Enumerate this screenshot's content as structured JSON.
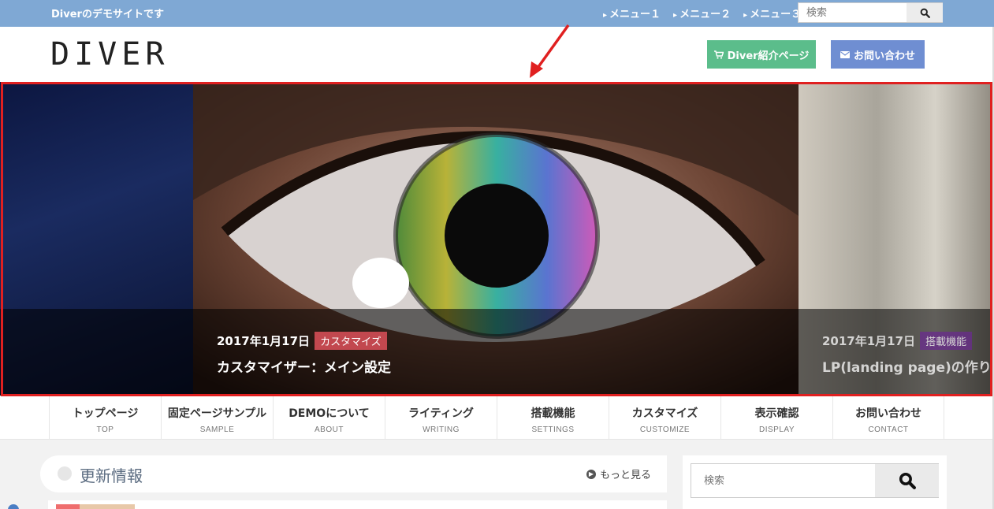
{
  "topbar": {
    "tagline": "Diverのデモサイトです",
    "menu": [
      "メニュー１",
      "メニュー２",
      "メニュー３"
    ],
    "search_placeholder": "検索"
  },
  "header": {
    "logo": "DIVER",
    "intro_button": "Diver紹介ページ",
    "contact_button": "お問い合わせ",
    "colors": {
      "intro": "#5bbd8b",
      "contact": "#6f8ed2"
    }
  },
  "slider": {
    "main": {
      "date": "2017年1月17日",
      "category": "カスタマイズ",
      "title": "カスタマイザー：メイン設定",
      "category_color": "#c2484f"
    },
    "next": {
      "date": "2017年1月17日",
      "category": "搭載機能",
      "title": "LP(landing page)の作り方",
      "category_color": "#6a2b8e"
    },
    "highlight_color": "#e02020"
  },
  "nav": [
    {
      "jp": "トップページ",
      "en": "TOP"
    },
    {
      "jp": "固定ページサンプル",
      "en": "SAMPLE"
    },
    {
      "jp": "DEMOについて",
      "en": "ABOUT"
    },
    {
      "jp": "ライティング",
      "en": "WRITING"
    },
    {
      "jp": "搭載機能",
      "en": "SETTINGS"
    },
    {
      "jp": "カスタマイズ",
      "en": "CUSTOMIZE"
    },
    {
      "jp": "表示確認",
      "en": "DISPLAY"
    },
    {
      "jp": "お問い合わせ",
      "en": "CONTACT"
    }
  ],
  "news": {
    "title": "更新情報",
    "more": "もっと見る"
  },
  "sidebar": {
    "search_placeholder": "検索"
  }
}
